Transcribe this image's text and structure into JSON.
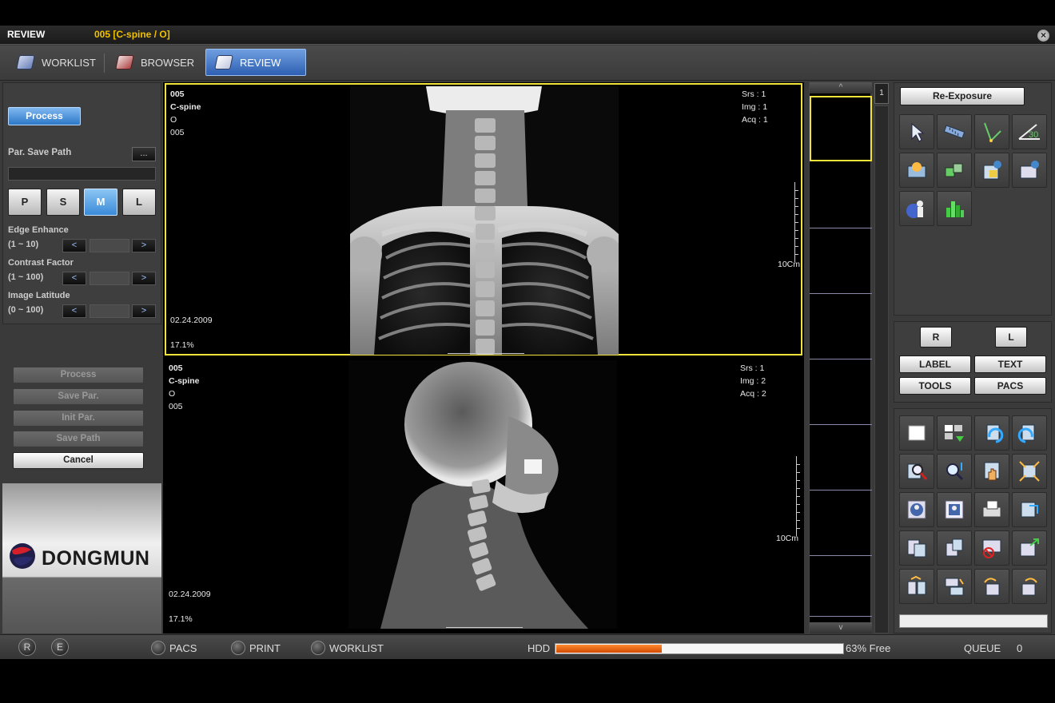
{
  "title": {
    "app": "REVIEW",
    "patient": "005 [C-spine / O]"
  },
  "tabs": [
    {
      "label": "WORKLIST"
    },
    {
      "label": "BROWSER"
    },
    {
      "label": "REVIEW",
      "active": true
    }
  ],
  "left": {
    "process_top": "Process",
    "save_path_label": "Par. Save Path",
    "browse": "...",
    "size_buttons": [
      "P",
      "S",
      "M",
      "L"
    ],
    "size_selected": "M",
    "params": [
      {
        "label": "Edge Enhance",
        "range": "(1 ~ 10)"
      },
      {
        "label": "Contrast Factor",
        "range": "(1 ~ 100)"
      },
      {
        "label": "Image Latitude",
        "range": "(0 ~  100)"
      }
    ],
    "arrows": [
      "<",
      ">"
    ],
    "actions": [
      "Process",
      "Save Par.",
      "Init Par.",
      "Save Path",
      "Cancel"
    ],
    "logo": "DONGMUN"
  },
  "panes": [
    {
      "id": "005",
      "body": "C-spine",
      "view": "O",
      "id2": "005",
      "srs": "Srs : 1",
      "img": "Img : 1",
      "acq": "Acq : 1",
      "date": "02.24.2009",
      "zoom": "17.1%",
      "scale": "10Cm"
    },
    {
      "id": "005",
      "body": "C-spine",
      "view": "O",
      "id2": "005",
      "srs": "Srs : 1",
      "img": "Img : 2",
      "acq": "Acq : 2",
      "date": "02.24.2009",
      "zoom": "17.1%",
      "scale": "10Cm"
    }
  ],
  "thumbs": {
    "page": "1",
    "up": "^",
    "down": "v"
  },
  "right": {
    "re_exposure": "Re-Exposure",
    "marker_r": "R",
    "marker_l": "L",
    "label_btn": "LABEL",
    "text_btn": "TEXT",
    "tools_btn": "TOOLS",
    "pacs_btn": "PACS",
    "angle_label": "30"
  },
  "status": {
    "r": "R",
    "e": "E",
    "pacs": "PACS",
    "print": "PRINT",
    "worklist": "WORKLIST",
    "hdd": "HDD",
    "hdd_used_fraction": 0.37,
    "hdd_free": "63% Free",
    "queue_label": "QUEUE",
    "queue_value": "0"
  }
}
